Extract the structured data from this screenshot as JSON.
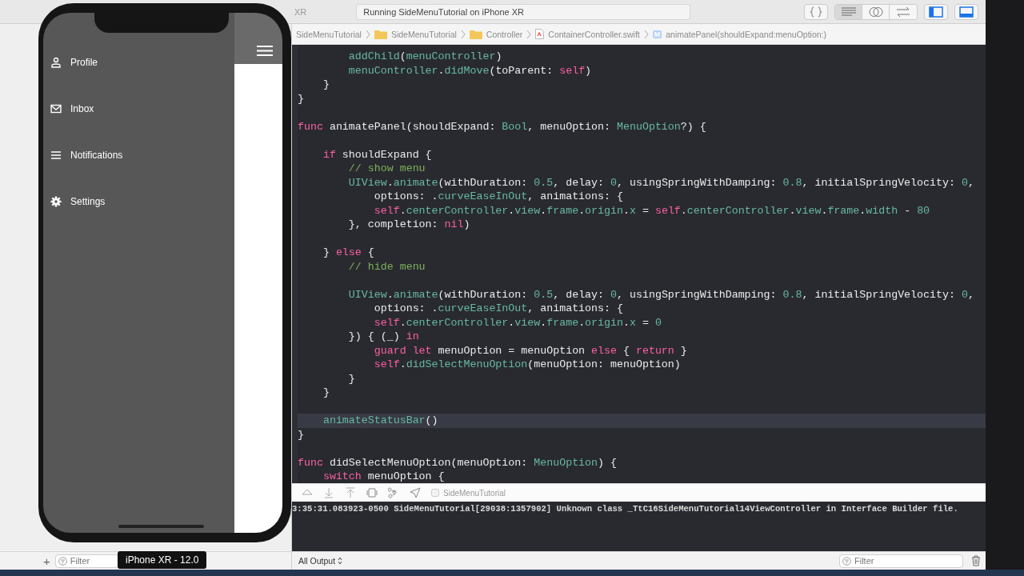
{
  "toolbar": {
    "scheme": "XR",
    "activity": "Running SideMenuTutorial on iPhone XR",
    "editor_modes": [
      {
        "kind": "standard",
        "selected": true
      },
      {
        "kind": "assistant",
        "selected": false
      },
      {
        "kind": "version",
        "selected": false
      }
    ]
  },
  "breadcrumb": [
    {
      "label": "SideMenuTutorial",
      "kind": "project"
    },
    {
      "label": "SideMenuTutorial",
      "kind": "folder"
    },
    {
      "label": "Controller",
      "kind": "folder"
    },
    {
      "label": "ContainerController.swift",
      "kind": "file"
    },
    {
      "label": "animatePanel(shouldExpand:menuOption:)",
      "kind": "method",
      "badge": "M"
    }
  ],
  "code": [
    {
      "current": false,
      "tokens": [
        {
          "s": "        addChild",
          "kind": "symbol"
        },
        {
          "s": "(",
          "kind": "plain"
        },
        {
          "s": "menuController",
          "kind": "symbol"
        },
        {
          "s": ")",
          "kind": "plain"
        }
      ]
    },
    {
      "current": false,
      "tokens": [
        {
          "s": "        menuController",
          "kind": "symbol"
        },
        {
          "s": ".",
          "kind": "plain"
        },
        {
          "s": "didMove",
          "kind": "symbol"
        },
        {
          "s": "(toParent: ",
          "kind": "plain"
        },
        {
          "s": "self",
          "kind": "keyword"
        },
        {
          "s": ")",
          "kind": "plain"
        }
      ]
    },
    {
      "current": false,
      "tokens": [
        {
          "s": "    }",
          "kind": "plain"
        }
      ]
    },
    {
      "current": false,
      "tokens": [
        {
          "s": "}",
          "kind": "plain"
        }
      ]
    },
    {
      "current": false,
      "blank_before": true,
      "tokens": [
        {
          "s": "func",
          "kind": "keyword"
        },
        {
          "s": " animatePanel(shouldExpand: ",
          "kind": "plain"
        },
        {
          "s": "Bool",
          "kind": "symbol"
        },
        {
          "s": ", menuOption: ",
          "kind": "plain"
        },
        {
          "s": "MenuOption",
          "kind": "symbol"
        },
        {
          "s": "?) {",
          "kind": "plain"
        }
      ]
    },
    {
      "current": false,
      "blank_before": true,
      "tokens": [
        {
          "s": "    if",
          "kind": "keyword"
        },
        {
          "s": " shouldExpand {",
          "kind": "plain"
        }
      ]
    },
    {
      "current": false,
      "tokens": [
        {
          "s": "        // show menu",
          "kind": "comment"
        }
      ]
    },
    {
      "current": false,
      "tokens": [
        {
          "s": "        UIView",
          "kind": "symbol"
        },
        {
          "s": ".",
          "kind": "plain"
        },
        {
          "s": "animate",
          "kind": "symbol"
        },
        {
          "s": "(withDuration: ",
          "kind": "plain"
        },
        {
          "s": "0.5",
          "kind": "symbol"
        },
        {
          "s": ", delay: ",
          "kind": "plain"
        },
        {
          "s": "0",
          "kind": "symbol"
        },
        {
          "s": ", usingSpringWithDamping: ",
          "kind": "plain"
        },
        {
          "s": "0.8",
          "kind": "symbol"
        },
        {
          "s": ", initialSpringVelocity: ",
          "kind": "plain"
        },
        {
          "s": "0",
          "kind": "symbol"
        },
        {
          "s": ",",
          "kind": "plain"
        }
      ]
    },
    {
      "current": false,
      "tokens": [
        {
          "s": "            options: .",
          "kind": "plain"
        },
        {
          "s": "curveEaseInOut",
          "kind": "symbol"
        },
        {
          "s": ", animations: {",
          "kind": "plain"
        }
      ]
    },
    {
      "current": false,
      "tokens": [
        {
          "s": "            self",
          "kind": "keyword"
        },
        {
          "s": ".",
          "kind": "plain"
        },
        {
          "s": "centerController",
          "kind": "symbol"
        },
        {
          "s": ".",
          "kind": "plain"
        },
        {
          "s": "view",
          "kind": "symbol"
        },
        {
          "s": ".",
          "kind": "plain"
        },
        {
          "s": "frame",
          "kind": "symbol"
        },
        {
          "s": ".",
          "kind": "plain"
        },
        {
          "s": "origin",
          "kind": "symbol"
        },
        {
          "s": ".",
          "kind": "plain"
        },
        {
          "s": "x",
          "kind": "symbol"
        },
        {
          "s": " = ",
          "kind": "plain"
        },
        {
          "s": "self",
          "kind": "keyword"
        },
        {
          "s": ".",
          "kind": "plain"
        },
        {
          "s": "centerController",
          "kind": "symbol"
        },
        {
          "s": ".",
          "kind": "plain"
        },
        {
          "s": "view",
          "kind": "symbol"
        },
        {
          "s": ".",
          "kind": "plain"
        },
        {
          "s": "frame",
          "kind": "symbol"
        },
        {
          "s": ".",
          "kind": "plain"
        },
        {
          "s": "width",
          "kind": "symbol"
        },
        {
          "s": " - ",
          "kind": "plain"
        },
        {
          "s": "80",
          "kind": "symbol"
        }
      ]
    },
    {
      "current": false,
      "tokens": [
        {
          "s": "        }, completion: ",
          "kind": "plain"
        },
        {
          "s": "nil",
          "kind": "keyword"
        },
        {
          "s": ")",
          "kind": "plain"
        }
      ]
    },
    {
      "current": false,
      "blank_before": true,
      "tokens": [
        {
          "s": "    } ",
          "kind": "plain"
        },
        {
          "s": "else",
          "kind": "keyword"
        },
        {
          "s": " {",
          "kind": "plain"
        }
      ]
    },
    {
      "current": false,
      "tokens": [
        {
          "s": "        // hide menu",
          "kind": "comment"
        }
      ]
    },
    {
      "current": false,
      "blank_before": true,
      "tokens": [
        {
          "s": "        UIView",
          "kind": "symbol"
        },
        {
          "s": ".",
          "kind": "plain"
        },
        {
          "s": "animate",
          "kind": "symbol"
        },
        {
          "s": "(withDuration: ",
          "kind": "plain"
        },
        {
          "s": "0.5",
          "kind": "symbol"
        },
        {
          "s": ", delay: ",
          "kind": "plain"
        },
        {
          "s": "0",
          "kind": "symbol"
        },
        {
          "s": ", usingSpringWithDamping: ",
          "kind": "plain"
        },
        {
          "s": "0.8",
          "kind": "symbol"
        },
        {
          "s": ", initialSpringVelocity: ",
          "kind": "plain"
        },
        {
          "s": "0",
          "kind": "symbol"
        },
        {
          "s": ",",
          "kind": "plain"
        }
      ]
    },
    {
      "current": false,
      "tokens": [
        {
          "s": "            options: .",
          "kind": "plain"
        },
        {
          "s": "curveEaseInOut",
          "kind": "symbol"
        },
        {
          "s": ", animations: {",
          "kind": "plain"
        }
      ]
    },
    {
      "current": false,
      "tokens": [
        {
          "s": "            self",
          "kind": "keyword"
        },
        {
          "s": ".",
          "kind": "plain"
        },
        {
          "s": "centerController",
          "kind": "symbol"
        },
        {
          "s": ".",
          "kind": "plain"
        },
        {
          "s": "view",
          "kind": "symbol"
        },
        {
          "s": ".",
          "kind": "plain"
        },
        {
          "s": "frame",
          "kind": "symbol"
        },
        {
          "s": ".",
          "kind": "plain"
        },
        {
          "s": "origin",
          "kind": "symbol"
        },
        {
          "s": ".",
          "kind": "plain"
        },
        {
          "s": "x",
          "kind": "symbol"
        },
        {
          "s": " = ",
          "kind": "plain"
        },
        {
          "s": "0",
          "kind": "symbol"
        }
      ]
    },
    {
      "current": false,
      "tokens": [
        {
          "s": "        }) { (_) ",
          "kind": "plain"
        },
        {
          "s": "in",
          "kind": "keyword"
        }
      ]
    },
    {
      "current": false,
      "tokens": [
        {
          "s": "            guard",
          "kind": "keyword"
        },
        {
          "s": " let",
          "kind": "keyword"
        },
        {
          "s": " menuOption = menuOption ",
          "kind": "plain"
        },
        {
          "s": "else",
          "kind": "keyword"
        },
        {
          "s": " { ",
          "kind": "plain"
        },
        {
          "s": "return",
          "kind": "keyword"
        },
        {
          "s": " }",
          "kind": "plain"
        }
      ]
    },
    {
      "current": false,
      "tokens": [
        {
          "s": "            self",
          "kind": "keyword"
        },
        {
          "s": ".",
          "kind": "plain"
        },
        {
          "s": "didSelectMenuOption",
          "kind": "symbol"
        },
        {
          "s": "(menuOption: menuOption)",
          "kind": "plain"
        }
      ]
    },
    {
      "current": false,
      "tokens": [
        {
          "s": "        }",
          "kind": "plain"
        }
      ]
    },
    {
      "current": false,
      "tokens": [
        {
          "s": "    }",
          "kind": "plain"
        }
      ]
    },
    {
      "current": true,
      "blank_before": true,
      "tokens": [
        {
          "s": "    animateStatusBar",
          "kind": "symbol"
        },
        {
          "s": "()",
          "kind": "plain"
        }
      ]
    },
    {
      "current": false,
      "tokens": [
        {
          "s": "}",
          "kind": "plain"
        }
      ]
    },
    {
      "current": false,
      "blank_before": true,
      "tokens": [
        {
          "s": "func",
          "kind": "keyword"
        },
        {
          "s": " didSelectMenuOption(menuOption: ",
          "kind": "plain"
        },
        {
          "s": "MenuOption",
          "kind": "symbol"
        },
        {
          "s": ") {",
          "kind": "plain"
        }
      ]
    },
    {
      "current": false,
      "tokens": [
        {
          "s": "    switch",
          "kind": "keyword"
        },
        {
          "s": " menuOption {",
          "kind": "plain"
        }
      ]
    }
  ],
  "debug_bar": {
    "target": "SideMenuTutorial"
  },
  "console": {
    "lines": [
      "3:35:31.083923-0500 SideMenuTutorial[29038:1357902] Unknown class _TtC16SideMenuTutorial14ViewController in Interface Builder file."
    ]
  },
  "bottom_bar": {
    "add": "+",
    "navigator_filter": {
      "placeholder": "Filter"
    },
    "output_menu": "All Output",
    "console_filter": {
      "placeholder": "Filter"
    }
  },
  "simulator": {
    "menu": [
      {
        "label": "Profile"
      },
      {
        "label": "Inbox"
      },
      {
        "label": "Notifications"
      },
      {
        "label": "Settings"
      }
    ],
    "tooltip": "iPhone XR - 12.0"
  }
}
